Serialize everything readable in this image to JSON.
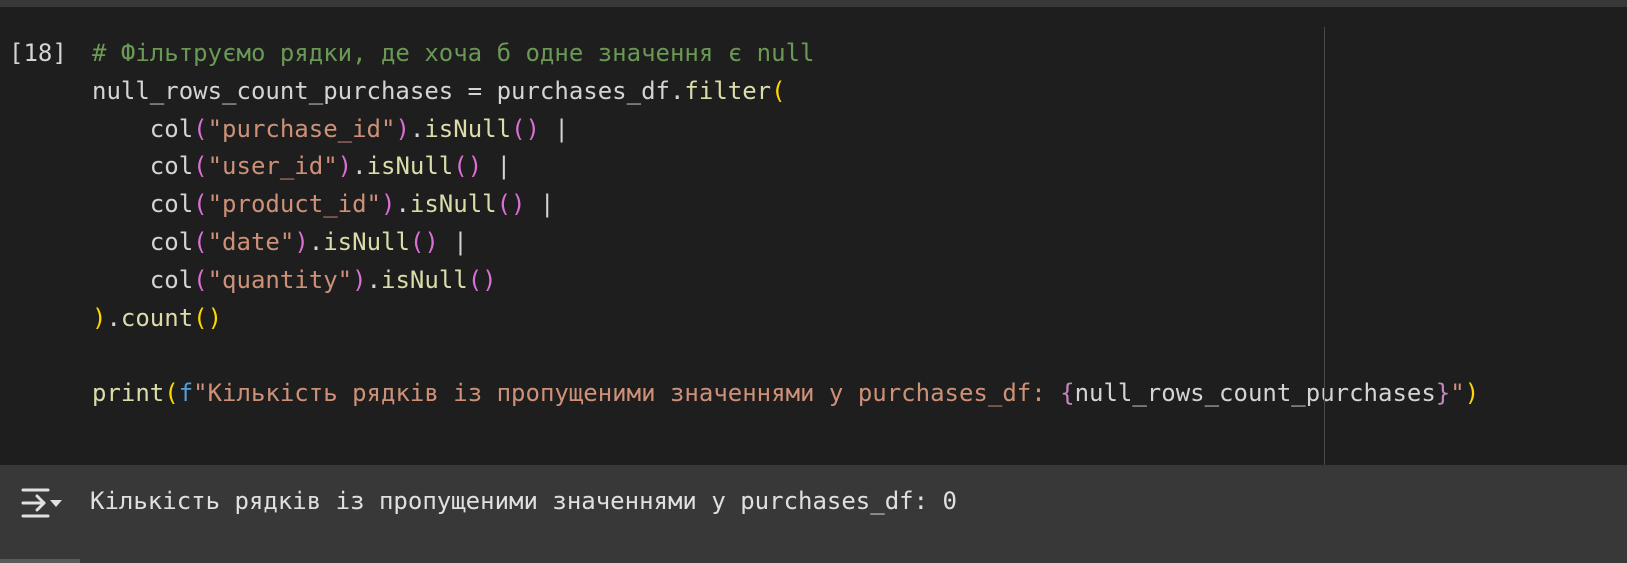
{
  "cell": {
    "execution_count": "[18]",
    "code_lines": [
      [
        {
          "t": "# Фільтруємо рядки, де хоча б одне значення є null",
          "k": "comment"
        }
      ],
      [
        {
          "t": "null_rows_count_purchases = purchases_df.",
          "k": "plain"
        },
        {
          "t": "filter",
          "k": "fn"
        },
        {
          "t": "(",
          "k": "paren-y"
        }
      ],
      [
        {
          "t": "    ",
          "k": "plain"
        },
        {
          "t": "col",
          "k": "plain"
        },
        {
          "t": "(",
          "k": "paren-p"
        },
        {
          "t": "\"purchase_id\"",
          "k": "str"
        },
        {
          "t": ")",
          "k": "paren-p"
        },
        {
          "t": ".",
          "k": "plain"
        },
        {
          "t": "isNull",
          "k": "fn"
        },
        {
          "t": "()",
          "k": "paren-p"
        },
        {
          "t": " |",
          "k": "plain"
        }
      ],
      [
        {
          "t": "    ",
          "k": "plain"
        },
        {
          "t": "col",
          "k": "plain"
        },
        {
          "t": "(",
          "k": "paren-p"
        },
        {
          "t": "\"user_id\"",
          "k": "str"
        },
        {
          "t": ")",
          "k": "paren-p"
        },
        {
          "t": ".",
          "k": "plain"
        },
        {
          "t": "isNull",
          "k": "fn"
        },
        {
          "t": "()",
          "k": "paren-p"
        },
        {
          "t": " |",
          "k": "plain"
        }
      ],
      [
        {
          "t": "    ",
          "k": "plain"
        },
        {
          "t": "col",
          "k": "plain"
        },
        {
          "t": "(",
          "k": "paren-p"
        },
        {
          "t": "\"product_id\"",
          "k": "str"
        },
        {
          "t": ")",
          "k": "paren-p"
        },
        {
          "t": ".",
          "k": "plain"
        },
        {
          "t": "isNull",
          "k": "fn"
        },
        {
          "t": "()",
          "k": "paren-p"
        },
        {
          "t": " |",
          "k": "plain"
        }
      ],
      [
        {
          "t": "    ",
          "k": "plain"
        },
        {
          "t": "col",
          "k": "plain"
        },
        {
          "t": "(",
          "k": "paren-p"
        },
        {
          "t": "\"date\"",
          "k": "str"
        },
        {
          "t": ")",
          "k": "paren-p"
        },
        {
          "t": ".",
          "k": "plain"
        },
        {
          "t": "isNull",
          "k": "fn"
        },
        {
          "t": "()",
          "k": "paren-p"
        },
        {
          "t": " |",
          "k": "plain"
        }
      ],
      [
        {
          "t": "    ",
          "k": "plain"
        },
        {
          "t": "col",
          "k": "plain"
        },
        {
          "t": "(",
          "k": "paren-p"
        },
        {
          "t": "\"quantity\"",
          "k": "str"
        },
        {
          "t": ")",
          "k": "paren-p"
        },
        {
          "t": ".",
          "k": "plain"
        },
        {
          "t": "isNull",
          "k": "fn"
        },
        {
          "t": "()",
          "k": "paren-p"
        }
      ],
      [
        {
          "t": ")",
          "k": "paren-y"
        },
        {
          "t": ".",
          "k": "plain"
        },
        {
          "t": "count",
          "k": "fn"
        },
        {
          "t": "()",
          "k": "paren-y"
        }
      ],
      [],
      [
        {
          "t": "print",
          "k": "fn"
        },
        {
          "t": "(",
          "k": "paren-y"
        },
        {
          "t": "f",
          "k": "kw"
        },
        {
          "t": "\"Кількість рядків із пропущеними значеннями у purchases_df: ",
          "k": "str"
        },
        {
          "t": "{",
          "k": "brace"
        },
        {
          "t": "null_rows_count_purchases",
          "k": "plain"
        },
        {
          "t": "}",
          "k": "brace"
        },
        {
          "t": "\"",
          "k": "str"
        },
        {
          "t": ")",
          "k": "paren-y"
        }
      ]
    ]
  },
  "output": {
    "icon": "output-toggle-icon",
    "text": "Кількість рядків із пропущеними значеннями у purchases_df: 0"
  },
  "colors": {
    "background": "#1e1e1e",
    "output_background": "#383838",
    "comment": "#6a9955",
    "function": "#dcdcaa",
    "string": "#ce9178",
    "keyword": "#569cd6"
  }
}
